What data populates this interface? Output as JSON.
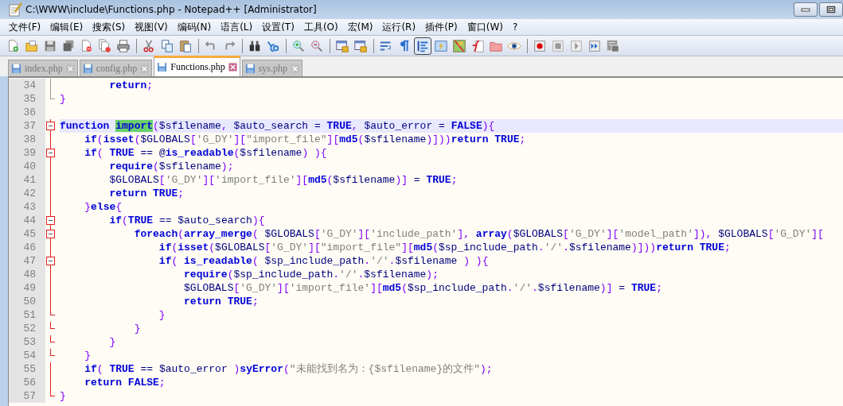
{
  "window": {
    "title": "C:\\WWW\\include\\Functions.php - Notepad++ [Administrator]"
  },
  "menu": [
    "文件(F)",
    "编辑(E)",
    "搜索(S)",
    "视图(V)",
    "编码(N)",
    "语言(L)",
    "设置(T)",
    "工具(O)",
    "宏(M)",
    "运行(R)",
    "插件(P)",
    "窗口(W)",
    "?"
  ],
  "toolbar_buttons": [
    {
      "pressed": false
    },
    {
      "pressed": false
    },
    {
      "pressed": false
    },
    {
      "pressed": false
    },
    {
      "pressed": false
    },
    {
      "pressed": false
    },
    {
      "pressed": false
    },
    {
      "pressed": false
    },
    {
      "pressed": false
    },
    {
      "pressed": false
    },
    {
      "pressed": false
    },
    {
      "pressed": false
    },
    {
      "pressed": false
    },
    {
      "pressed": false
    },
    {
      "pressed": false
    },
    {
      "pressed": false
    },
    {
      "pressed": false
    },
    {
      "pressed": false
    },
    {
      "pressed": false
    },
    {
      "pressed": false
    },
    {
      "pressed": true
    },
    {
      "pressed": false
    },
    {
      "pressed": false
    },
    {
      "pressed": false
    },
    {
      "pressed": false
    },
    {
      "pressed": false
    },
    {
      "pressed": false
    },
    {
      "pressed": false
    },
    {
      "pressed": false
    },
    {
      "pressed": false
    },
    {
      "pressed": false
    }
  ],
  "tabs": [
    {
      "label": "index.php",
      "selected": false
    },
    {
      "label": "config.php",
      "selected": false
    },
    {
      "label": "Functions.php",
      "selected": true
    },
    {
      "label": "sys.php",
      "selected": false
    }
  ],
  "lines": [
    {
      "number": "34",
      "kind": "line",
      "active_block": false,
      "current": false,
      "text": "        return;"
    },
    {
      "number": "35",
      "kind": "end",
      "active_block": false,
      "current": false,
      "text": "}"
    },
    {
      "number": "36",
      "kind": "none",
      "current": false
    },
    {
      "number": "37",
      "kind": "start",
      "active_block": true,
      "current": true,
      "segments": [
        {
          "text": "function ",
          "match": false
        },
        {
          "text": "import",
          "match": true
        },
        {
          "text": "($sfilename, $auto_search = TRUE, $auto_error = FALSE){",
          "match": false
        }
      ]
    },
    {
      "number": "38",
      "kind": "line",
      "active_block": true,
      "current": false,
      "text": "    if(isset($GLOBALS['G_DY'][\"import_file\"][md5($sfilename)]))return TRUE;"
    },
    {
      "number": "39",
      "kind": "start",
      "active_block": true,
      "current": false,
      "text": "    if( TRUE == @is_readable($sfilename) ){"
    },
    {
      "number": "40",
      "kind": "line",
      "active_block": true,
      "current": false,
      "text": "        require($sfilename);"
    },
    {
      "number": "41",
      "kind": "line",
      "active_block": true,
      "current": false,
      "text": "        $GLOBALS['G_DY']['import_file'][md5($sfilename)] = TRUE;"
    },
    {
      "number": "42",
      "kind": "line",
      "active_block": true,
      "current": false,
      "text": "        return TRUE;"
    },
    {
      "number": "43",
      "kind": "line",
      "active_block": true,
      "current": false,
      "text": "    }else{"
    },
    {
      "number": "44",
      "kind": "start",
      "active_block": true,
      "current": false,
      "text": "        if(TRUE == $auto_search){"
    },
    {
      "number": "45",
      "kind": "start",
      "active_block": true,
      "current": false,
      "text": "            foreach(array_merge( $GLOBALS['G_DY']['include_path'], array($GLOBALS['G_DY']['model_path']), $GLOBALS['G_DY']["
    },
    {
      "number": "46",
      "kind": "line",
      "active_block": true,
      "current": false,
      "text": "                if(isset($GLOBALS['G_DY'][\"import_file\"][md5($sp_include_path.'/'.$sfilename)]))return TRUE;"
    },
    {
      "number": "47",
      "kind": "start",
      "active_block": true,
      "current": false,
      "text": "                if( is_readable( $sp_include_path.'/'.$sfilename ) ){"
    },
    {
      "number": "48",
      "kind": "line",
      "active_block": true,
      "current": false,
      "text": "                    require($sp_include_path.'/'.$sfilename);"
    },
    {
      "number": "49",
      "kind": "line",
      "active_block": true,
      "current": false,
      "text": "                    $GLOBALS['G_DY']['import_file'][md5($sp_include_path.'/'.$sfilename)] = TRUE;"
    },
    {
      "number": "50",
      "kind": "line",
      "active_block": true,
      "current": false,
      "text": "                    return TRUE;"
    },
    {
      "number": "51",
      "kind": "end",
      "active_block": true,
      "current": false,
      "text": "                }"
    },
    {
      "number": "52",
      "kind": "end",
      "active_block": true,
      "current": false,
      "text": "            }"
    },
    {
      "number": "53",
      "kind": "end",
      "active_block": true,
      "current": false,
      "text": "        }"
    },
    {
      "number": "54",
      "kind": "end",
      "active_block": true,
      "current": false,
      "text": "    }"
    },
    {
      "number": "55",
      "kind": "line",
      "active_block": true,
      "current": false,
      "text": "    if( TRUE == $auto_error )syError(\"未能找到名为：{$sfilename}的文件\");"
    },
    {
      "number": "56",
      "kind": "line",
      "active_block": true,
      "current": false,
      "text": "    return FALSE;"
    },
    {
      "number": "57",
      "kind": "end",
      "active_block": true,
      "current": false,
      "text": "}"
    }
  ]
}
